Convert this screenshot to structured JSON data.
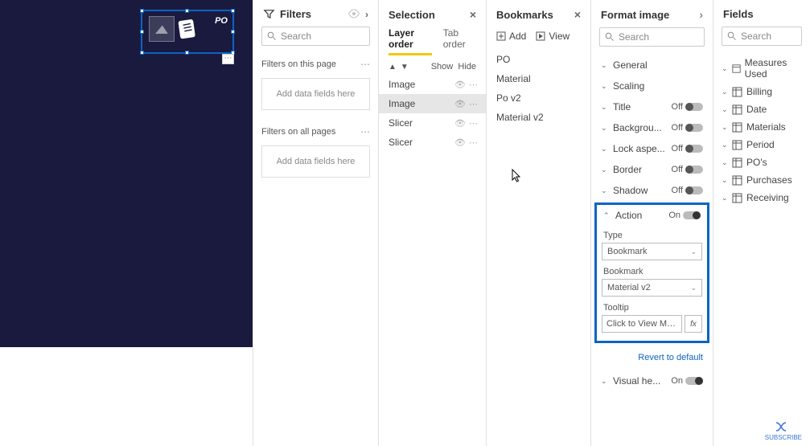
{
  "canvas": {
    "po_label": "PO"
  },
  "filters": {
    "title": "Filters",
    "search_placeholder": "Search",
    "section_page": "Filters on this page",
    "section_all": "Filters on all pages",
    "drop_hint": "Add data fields here"
  },
  "selection": {
    "title": "Selection",
    "tabs": {
      "layer": "Layer order",
      "tab": "Tab order"
    },
    "show": "Show",
    "hide": "Hide",
    "items": [
      "Image",
      "Image",
      "Slicer",
      "Slicer"
    ]
  },
  "bookmarks": {
    "title": "Bookmarks",
    "add": "Add",
    "view": "View",
    "items": [
      "PO",
      "Material",
      "Po v2",
      "Material v2"
    ]
  },
  "format": {
    "title": "Format image",
    "search_placeholder": "Search",
    "rows": {
      "general": "General",
      "scaling": "Scaling",
      "title_row": "Title",
      "background": "Backgrou...",
      "lock": "Lock aspe...",
      "border": "Border",
      "shadow": "Shadow",
      "action": "Action",
      "visual_header": "Visual he..."
    },
    "off": "Off",
    "on": "On",
    "action_panel": {
      "type_label": "Type",
      "type_value": "Bookmark",
      "bookmark_label": "Bookmark",
      "bookmark_value": "Material v2",
      "tooltip_label": "Tooltip",
      "tooltip_value": "Click to View Mate..."
    },
    "revert": "Revert to default"
  },
  "fields": {
    "title": "Fields",
    "search_placeholder": "Search",
    "tables": [
      "Measures Used",
      "Billing",
      "Date",
      "Materials",
      "Period",
      "PO's",
      "Purchases",
      "Receiving"
    ]
  },
  "subscribe": "SUBSCRIBE"
}
